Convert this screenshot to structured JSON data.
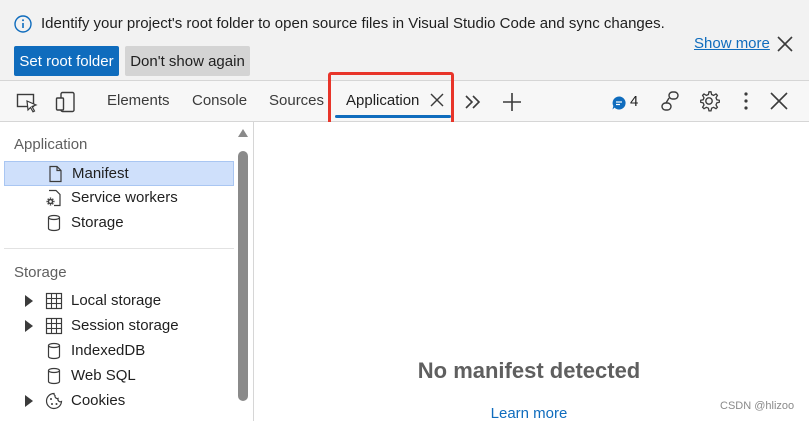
{
  "infobar": {
    "message": "Identify your project's root folder to open source files in Visual Studio Code and sync changes.",
    "primary_button": "Set root folder",
    "secondary_button": "Don't show again",
    "show_more": "Show more",
    "close_icon": "close-icon",
    "info_icon": "info-icon"
  },
  "toolbar": {
    "tabs": [
      {
        "label": "Elements"
      },
      {
        "label": "Console"
      },
      {
        "label": "Sources"
      },
      {
        "label": "Application",
        "active": true
      }
    ],
    "issues_count": "4",
    "icons": [
      "inspect-element-icon",
      "device-emulation-icon",
      "more-tabs-icon",
      "add-tab-icon",
      "issues-icon",
      "connections-icon",
      "settings-icon",
      "more-options-icon",
      "close-devtools-icon"
    ]
  },
  "sidebar": {
    "application_header": "Application",
    "application_items": [
      {
        "label": "Manifest",
        "icon": "file-icon",
        "selected": true
      },
      {
        "label": "Service workers",
        "icon": "gear-icon"
      },
      {
        "label": "Storage",
        "icon": "database-icon"
      }
    ],
    "storage_header": "Storage",
    "storage_items": [
      {
        "label": "Local storage",
        "icon": "grid-icon",
        "expandable": true
      },
      {
        "label": "Session storage",
        "icon": "grid-icon",
        "expandable": true
      },
      {
        "label": "IndexedDB",
        "icon": "database-icon"
      },
      {
        "label": "Web SQL",
        "icon": "database-icon"
      },
      {
        "label": "Cookies",
        "icon": "cookie-icon",
        "expandable": true
      }
    ]
  },
  "main": {
    "message": "No manifest detected",
    "link": "Learn more"
  },
  "watermark": "CSDN @hlizoo",
  "colors": {
    "accent": "#0f6cbd",
    "highlight": "#e8352a",
    "selected_bg": "#cfe0fb"
  }
}
